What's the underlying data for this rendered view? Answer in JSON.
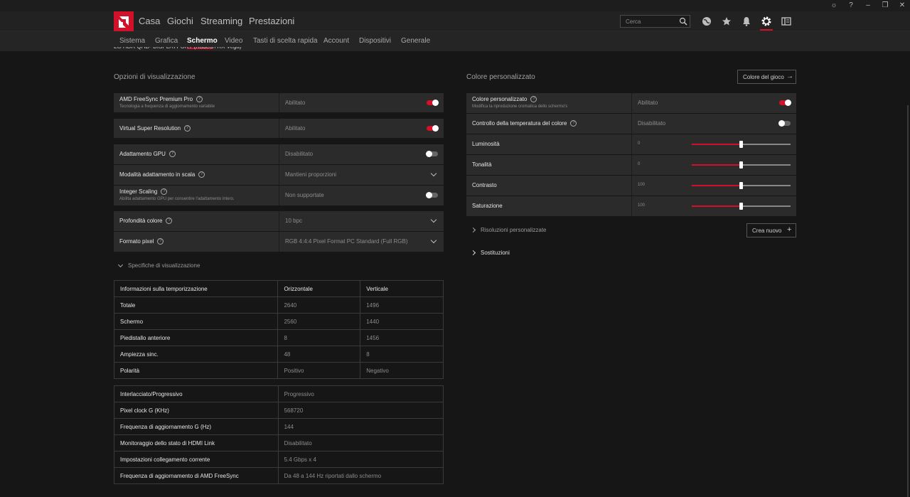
{
  "topnav": {
    "items": [
      "Casa",
      "Giochi",
      "Streaming",
      "Prestazioni"
    ],
    "search_placeholder": "Cerca"
  },
  "subnav": {
    "items": [
      "Sistema",
      "Grafica",
      "Schermo",
      "Video",
      "Tasti di scelta rapida",
      "Account",
      "Dispositivi",
      "Generale"
    ],
    "active": "Schermo"
  },
  "monitor_name": "LG HDR QHD- DISPLAYPORT (Radeon RX Vega)",
  "display_options": {
    "title": "Opzioni di visualizzazione",
    "freesync": {
      "label": "AMD FreeSync Premium Pro",
      "sub": "Tecnologia a frequenza di aggiornamento variabile",
      "value": "Abilitato"
    },
    "vsr": {
      "label": "Virtual Super Resolution",
      "value": "Abilitato"
    },
    "gpu_scaling": {
      "label": "Adattamento GPU",
      "value": "Disabilitato"
    },
    "scaling_mode": {
      "label": "Modalità adattamento in scala",
      "value": "Mantieni proporzioni"
    },
    "integer_scaling": {
      "label": "Integer Scaling",
      "sub": "Abilita adattamento GPU per consentire l'adattamento intero.",
      "value": "Non supportate"
    },
    "color_depth": {
      "label": "Profondità colore",
      "value": "10 bpc"
    },
    "pixel_format": {
      "label": "Formato pixel",
      "value": "RGB 4:4:4 Pixel Format PC Standard (Full RGB)"
    }
  },
  "specs": {
    "expander": "Specifiche di visualizzazione",
    "timing_header": [
      "Informazioni sulla temporizzazione",
      "Orizzontale",
      "Verticale"
    ],
    "timing_rows": [
      [
        "Totale",
        "2640",
        "1496"
      ],
      [
        "Schermo",
        "2560",
        "1440"
      ],
      [
        "Piedistallo anteriore",
        "8",
        "1456"
      ],
      [
        "Ampiezza sinc.",
        "48",
        "8"
      ],
      [
        "Polarità",
        "Positivo",
        "Negativo"
      ]
    ],
    "info_rows": [
      [
        "Interlacciato/Progressivo",
        "Progressivo"
      ],
      [
        "Pixel clock G (KHz)",
        "568720"
      ],
      [
        "Frequenza di aggiornamento G (Hz)",
        "144"
      ],
      [
        "Monitoraggio dello stato di HDMI Link",
        "Disabilitato"
      ],
      [
        "Impostazioni collegamento corrente",
        "5.4 Gbps x 4"
      ],
      [
        "Frequenza di aggiornamento di AMD FreeSync",
        "Da 48 a 144 Hz riportati dallo schermo"
      ]
    ]
  },
  "custom_color": {
    "title": "Colore personalizzato",
    "game_color_button": "Colore del gioco",
    "enabled": {
      "label": "Colore personalizzato",
      "sub": "Modifica la riproduzione cromatica dello schermo's",
      "value": "Abilitato"
    },
    "temp_control": {
      "label": "Controllo della temperatura del colore",
      "value": "Disabilitato"
    },
    "sliders": [
      {
        "label": "Luminosità",
        "value": "0",
        "level": 0.5
      },
      {
        "label": "Tonalità",
        "value": "0",
        "level": 0.5
      },
      {
        "label": "Contrasto",
        "value": "100",
        "level": 0.5
      },
      {
        "label": "Saturazione",
        "value": "100",
        "level": 0.5
      }
    ],
    "custom_resolutions": "Risoluzioni personalizzate",
    "create_new": "Crea nuovo",
    "overrides": "Sostituzioni"
  },
  "colors": {
    "accent": "#d3102a"
  }
}
